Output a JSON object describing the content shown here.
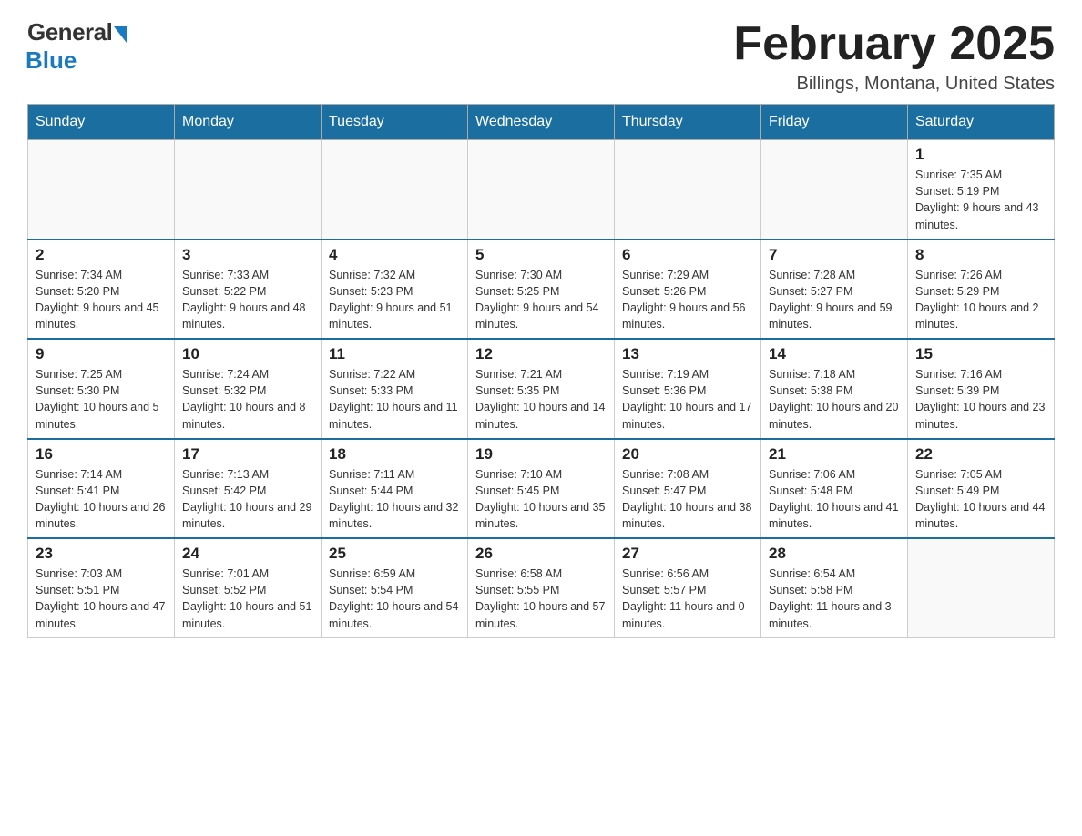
{
  "header": {
    "logo_general": "General",
    "logo_blue": "Blue",
    "month_title": "February 2025",
    "location": "Billings, Montana, United States"
  },
  "days_of_week": [
    "Sunday",
    "Monday",
    "Tuesday",
    "Wednesday",
    "Thursday",
    "Friday",
    "Saturday"
  ],
  "weeks": [
    [
      {
        "day": "",
        "info": ""
      },
      {
        "day": "",
        "info": ""
      },
      {
        "day": "",
        "info": ""
      },
      {
        "day": "",
        "info": ""
      },
      {
        "day": "",
        "info": ""
      },
      {
        "day": "",
        "info": ""
      },
      {
        "day": "1",
        "info": "Sunrise: 7:35 AM\nSunset: 5:19 PM\nDaylight: 9 hours and 43 minutes."
      }
    ],
    [
      {
        "day": "2",
        "info": "Sunrise: 7:34 AM\nSunset: 5:20 PM\nDaylight: 9 hours and 45 minutes."
      },
      {
        "day": "3",
        "info": "Sunrise: 7:33 AM\nSunset: 5:22 PM\nDaylight: 9 hours and 48 minutes."
      },
      {
        "day": "4",
        "info": "Sunrise: 7:32 AM\nSunset: 5:23 PM\nDaylight: 9 hours and 51 minutes."
      },
      {
        "day": "5",
        "info": "Sunrise: 7:30 AM\nSunset: 5:25 PM\nDaylight: 9 hours and 54 minutes."
      },
      {
        "day": "6",
        "info": "Sunrise: 7:29 AM\nSunset: 5:26 PM\nDaylight: 9 hours and 56 minutes."
      },
      {
        "day": "7",
        "info": "Sunrise: 7:28 AM\nSunset: 5:27 PM\nDaylight: 9 hours and 59 minutes."
      },
      {
        "day": "8",
        "info": "Sunrise: 7:26 AM\nSunset: 5:29 PM\nDaylight: 10 hours and 2 minutes."
      }
    ],
    [
      {
        "day": "9",
        "info": "Sunrise: 7:25 AM\nSunset: 5:30 PM\nDaylight: 10 hours and 5 minutes."
      },
      {
        "day": "10",
        "info": "Sunrise: 7:24 AM\nSunset: 5:32 PM\nDaylight: 10 hours and 8 minutes."
      },
      {
        "day": "11",
        "info": "Sunrise: 7:22 AM\nSunset: 5:33 PM\nDaylight: 10 hours and 11 minutes."
      },
      {
        "day": "12",
        "info": "Sunrise: 7:21 AM\nSunset: 5:35 PM\nDaylight: 10 hours and 14 minutes."
      },
      {
        "day": "13",
        "info": "Sunrise: 7:19 AM\nSunset: 5:36 PM\nDaylight: 10 hours and 17 minutes."
      },
      {
        "day": "14",
        "info": "Sunrise: 7:18 AM\nSunset: 5:38 PM\nDaylight: 10 hours and 20 minutes."
      },
      {
        "day": "15",
        "info": "Sunrise: 7:16 AM\nSunset: 5:39 PM\nDaylight: 10 hours and 23 minutes."
      }
    ],
    [
      {
        "day": "16",
        "info": "Sunrise: 7:14 AM\nSunset: 5:41 PM\nDaylight: 10 hours and 26 minutes."
      },
      {
        "day": "17",
        "info": "Sunrise: 7:13 AM\nSunset: 5:42 PM\nDaylight: 10 hours and 29 minutes."
      },
      {
        "day": "18",
        "info": "Sunrise: 7:11 AM\nSunset: 5:44 PM\nDaylight: 10 hours and 32 minutes."
      },
      {
        "day": "19",
        "info": "Sunrise: 7:10 AM\nSunset: 5:45 PM\nDaylight: 10 hours and 35 minutes."
      },
      {
        "day": "20",
        "info": "Sunrise: 7:08 AM\nSunset: 5:47 PM\nDaylight: 10 hours and 38 minutes."
      },
      {
        "day": "21",
        "info": "Sunrise: 7:06 AM\nSunset: 5:48 PM\nDaylight: 10 hours and 41 minutes."
      },
      {
        "day": "22",
        "info": "Sunrise: 7:05 AM\nSunset: 5:49 PM\nDaylight: 10 hours and 44 minutes."
      }
    ],
    [
      {
        "day": "23",
        "info": "Sunrise: 7:03 AM\nSunset: 5:51 PM\nDaylight: 10 hours and 47 minutes."
      },
      {
        "day": "24",
        "info": "Sunrise: 7:01 AM\nSunset: 5:52 PM\nDaylight: 10 hours and 51 minutes."
      },
      {
        "day": "25",
        "info": "Sunrise: 6:59 AM\nSunset: 5:54 PM\nDaylight: 10 hours and 54 minutes."
      },
      {
        "day": "26",
        "info": "Sunrise: 6:58 AM\nSunset: 5:55 PM\nDaylight: 10 hours and 57 minutes."
      },
      {
        "day": "27",
        "info": "Sunrise: 6:56 AM\nSunset: 5:57 PM\nDaylight: 11 hours and 0 minutes."
      },
      {
        "day": "28",
        "info": "Sunrise: 6:54 AM\nSunset: 5:58 PM\nDaylight: 11 hours and 3 minutes."
      },
      {
        "day": "",
        "info": ""
      }
    ]
  ]
}
